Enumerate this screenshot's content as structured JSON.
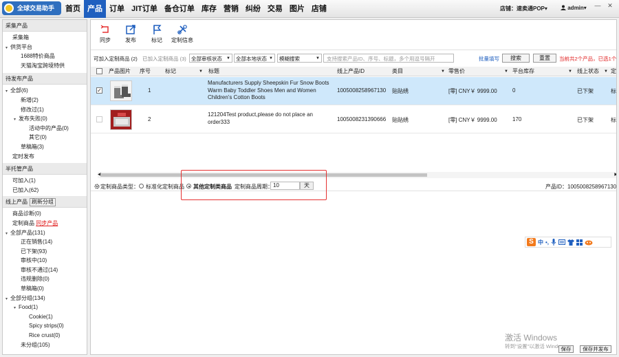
{
  "app": {
    "logo_text": "全球交易助手"
  },
  "nav": [
    {
      "label": "首页"
    },
    {
      "label": "产品"
    },
    {
      "label": "订单"
    },
    {
      "label": "JIT订单"
    },
    {
      "label": "备仓订单"
    },
    {
      "label": "库存"
    },
    {
      "label": "营销"
    },
    {
      "label": "纠纷"
    },
    {
      "label": "交易"
    },
    {
      "label": "图片"
    },
    {
      "label": "店铺"
    }
  ],
  "nav_active": "产品",
  "header": {
    "store_label": "店铺：速卖通POP",
    "store_arrow": "▾",
    "user_label": "admin",
    "user_arrow": "▾",
    "minimize": "—",
    "close": "✕"
  },
  "sidebar": {
    "collect_head": "采集产品",
    "collect_box": "采集箱",
    "supply": "供货平台",
    "supply_1688": "1688特价商品",
    "supply_tmall": "天猫淘宝跨境特供",
    "pending_head": "待发布产品",
    "all": "全部(6)",
    "new": "新增(2)",
    "modified": "修改过(1)",
    "failed": "发布失败(0)",
    "active_products": "活动中的产品(0)",
    "other": "其它(0)",
    "draft": "草稿箱(3)",
    "scheduled": "定时发布",
    "semi_head": "半托管产品",
    "joinable": "可加入(1)",
    "joined": "已加入(62)",
    "online_head": "线上产品",
    "refresh_group": "刷新分组",
    "diagnosis": "商品诊断(0)",
    "custom": "定制商品",
    "sync": "同步产品",
    "all_products": "全部产品(131)",
    "on_sale": "正在销售(14)",
    "off_shelf": "已下架(93)",
    "reviewing": "审核中(10)",
    "rejected": "审核不通过(14)",
    "violation_deleted": "违规删除(0)",
    "draft_box": "草稿箱(0)",
    "all_groups": "全部分组(134)",
    "food": "Food(1)",
    "cookie": "Cookie(1)",
    "spicy": "Spicy strips(0)",
    "rice": "Rice crust(0)",
    "ungrouped": "未分组(105)"
  },
  "toolbar": {
    "sync": "同步",
    "publish": "发布",
    "mark": "标记",
    "custom_info": "定制信息"
  },
  "filter": {
    "tab_can_add": "可加入定制商品 (2)",
    "tab_added": "已加入定制商品 (3)",
    "review_status": "全部审核状态",
    "local_status": "全部本地状态",
    "fuzzy": "模糊搜索",
    "search_placeholder": "支持搜索产品ID、序号、标题，多个用逗号隔开",
    "batch_fill": "批量填写",
    "search_btn": "搜索",
    "reset_btn": "重置",
    "summary": "当前共2个产品，已选1个"
  },
  "table": {
    "headers": {
      "image": "产品图片",
      "no": "序号",
      "mark": "标记",
      "title": "标题",
      "online_id": "线上产品ID",
      "category": "类目",
      "retail": "零售价",
      "stock": "平台库存",
      "status": "线上状态",
      "custom": "定制"
    },
    "rows": [
      {
        "checked": "✓",
        "no": "1",
        "title": "Manufacturers Supply Sheepskin Fur Snow Boots Warm Baby Toddler Shoes Men and Women Children's Cotton Boots",
        "online_id": "1005008258967130",
        "category": "贴贴绣",
        "retail": "[零] CNY￥ 9999.00",
        "stock": "0",
        "status": "已下架",
        "custom": "标准"
      },
      {
        "checked": "",
        "no": "2",
        "title": "121204Test product,please do not place an order333",
        "online_id": "1005008231390666",
        "category": "贴贴绣",
        "retail": "[零] CNY￥ 9999.00",
        "stock": "170",
        "status": "已下架",
        "custom": "标准"
      }
    ]
  },
  "custom_type": {
    "label": "定制商品类型：",
    "standard": "标准化定制商品",
    "other": "其他定制类商品",
    "cycle_label": "定制商品周期：",
    "cycle_value": "10",
    "cycle_unit": "天",
    "product_id": "产品ID：1005008258967130"
  },
  "ime": {
    "s_label": "S",
    "zh": "中"
  },
  "watermark": {
    "line1": "激活 Windows",
    "line2": "转到\"设置\"以激活 Windows。"
  },
  "footer": {
    "save": "保存",
    "save_publish": "保存并发布"
  }
}
